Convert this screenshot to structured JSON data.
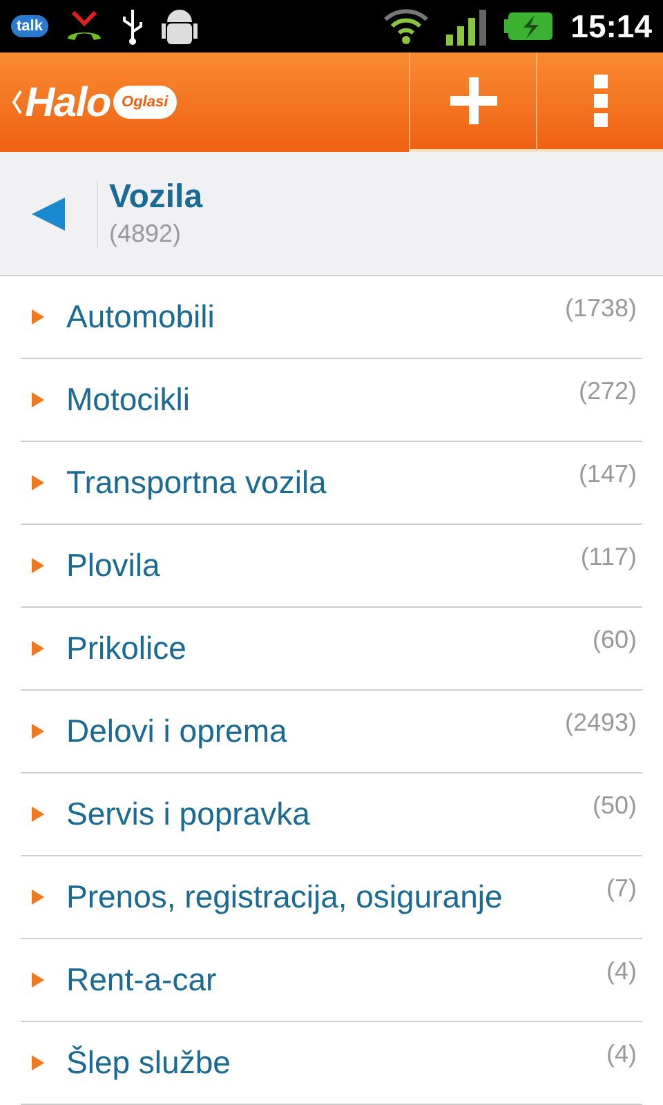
{
  "status_bar": {
    "chat_label": "talk",
    "time": "15:14"
  },
  "app_bar": {
    "logo": {
      "primary": "Halo",
      "secondary": "Oglasi"
    }
  },
  "category": {
    "title": "Vozila",
    "count": "(4892)"
  },
  "subcategories": [
    {
      "name": "Automobili",
      "count": "(1738)"
    },
    {
      "name": "Motocikli",
      "count": "(272)"
    },
    {
      "name": "Transportna vozila",
      "count": "(147)"
    },
    {
      "name": "Plovila",
      "count": "(117)"
    },
    {
      "name": "Prikolice",
      "count": "(60)"
    },
    {
      "name": "Delovi i oprema",
      "count": "(2493)"
    },
    {
      "name": "Servis i popravka",
      "count": "(50)"
    },
    {
      "name": "Prenos, registracija, osiguranje",
      "count": "(7)"
    },
    {
      "name": "Rent-a-car",
      "count": "(4)"
    },
    {
      "name": "Šlep službe",
      "count": "(4)"
    }
  ]
}
